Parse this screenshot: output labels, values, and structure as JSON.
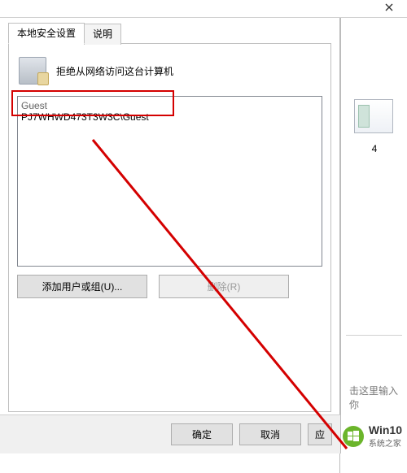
{
  "titlebar": {
    "text": ""
  },
  "tabs": {
    "active": "本地安全设置",
    "inactive": "说明"
  },
  "policy": {
    "title": "拒绝从网络访问这台计算机"
  },
  "listbox": {
    "entries": [
      {
        "text": "Guest",
        "style": "faded"
      },
      {
        "text": "PJ7WHWD473T3W3C\\Guest",
        "style": "normal"
      }
    ]
  },
  "buttons": {
    "add_user_group": "添加用户或组(U)...",
    "remove": "删除(R)"
  },
  "footer": {
    "ok": "确定",
    "cancel": "取消",
    "apply": "应"
  },
  "right_pane": {
    "thumb_label": "4",
    "hint": "击这里输入你"
  },
  "watermark": {
    "line1": "Win10",
    "line2": "系统之家"
  }
}
